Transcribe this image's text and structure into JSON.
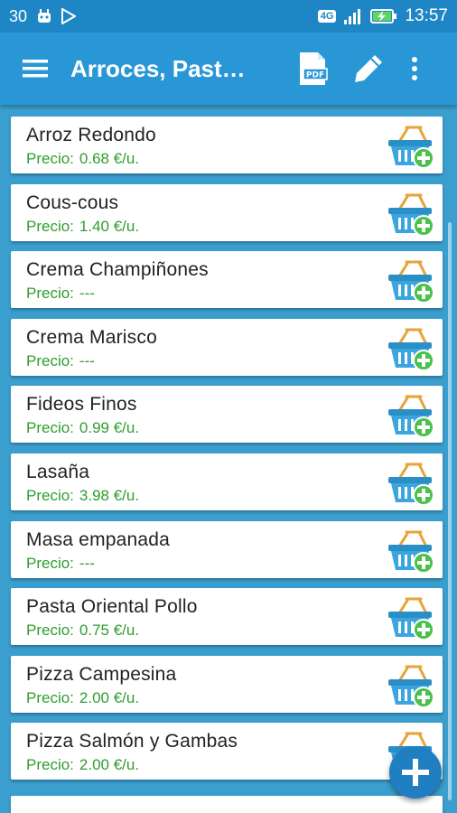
{
  "status_bar": {
    "left_text": "30",
    "network": "4G",
    "time": "13:57"
  },
  "app_bar": {
    "title": "Arroces, Past…",
    "pdf_label": "PDF",
    "icons": [
      "menu-icon",
      "pdf-icon",
      "pencil-icon",
      "more-vert-icon"
    ]
  },
  "colors": {
    "app_bar": "#2996d6",
    "background": "#3a9fcf",
    "price_text": "#2e9e2e",
    "fab": "#1f7fc2"
  },
  "products": [
    {
      "name": "Arroz Redondo",
      "price_label": "Precio:",
      "price": "0.68 €/u."
    },
    {
      "name": "Cous-cous",
      "price_label": "Precio:",
      "price": "1.40 €/u."
    },
    {
      "name": "Crema Champiñones",
      "price_label": "Precio:",
      "price": "---"
    },
    {
      "name": "Crema Marisco",
      "price_label": "Precio:",
      "price": "---"
    },
    {
      "name": "Fideos Finos",
      "price_label": "Precio:",
      "price": "0.99 €/u."
    },
    {
      "name": "Lasaña",
      "price_label": "Precio:",
      "price": "3.98 €/u."
    },
    {
      "name": "Masa empanada",
      "price_label": "Precio:",
      "price": "---"
    },
    {
      "name": "Pasta Oriental Pollo",
      "price_label": "Precio:",
      "price": "0.75 €/u."
    },
    {
      "name": "Pizza Campesina",
      "price_label": "Precio:",
      "price": "2.00 €/u."
    },
    {
      "name": "Pizza Salmón y Gambas",
      "price_label": "Precio:",
      "price": "2.00 €/u."
    }
  ]
}
